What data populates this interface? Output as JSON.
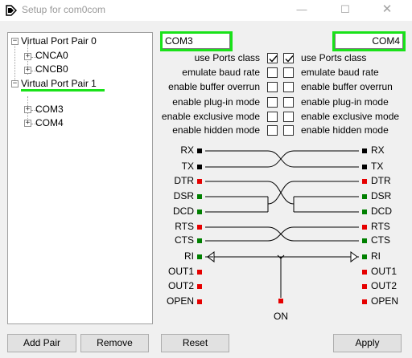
{
  "window": {
    "title": "Setup for com0com",
    "minimize": "—",
    "maximize": "☐",
    "close": "✕"
  },
  "tree": {
    "pairs": [
      {
        "label": "Virtual Port Pair 0",
        "toggle": "−",
        "children": [
          {
            "label": "CNCA0",
            "toggle": "+"
          },
          {
            "label": "CNCB0",
            "toggle": "+"
          }
        ]
      },
      {
        "label": "Virtual Port Pair 1",
        "toggle": "−",
        "children": [
          {
            "label": "COM3",
            "toggle": "+"
          },
          {
            "label": "COM4",
            "toggle": "+"
          }
        ]
      }
    ]
  },
  "ports": {
    "left_name": "COM3",
    "right_name": "COM4"
  },
  "options": {
    "left": [
      {
        "label": "use Ports class",
        "checked": true
      },
      {
        "label": "emulate baud rate",
        "checked": false
      },
      {
        "label": "enable buffer overrun",
        "checked": false
      },
      {
        "label": "enable plug-in mode",
        "checked": false
      },
      {
        "label": "enable exclusive mode",
        "checked": false
      },
      {
        "label": "enable hidden mode",
        "checked": false
      }
    ],
    "right": [
      {
        "label": "use Ports class",
        "checked": true
      },
      {
        "label": "emulate baud rate",
        "checked": false
      },
      {
        "label": "enable buffer overrun",
        "checked": false
      },
      {
        "label": "enable plug-in mode",
        "checked": false
      },
      {
        "label": "enable exclusive mode",
        "checked": false
      },
      {
        "label": "enable hidden mode",
        "checked": false
      }
    ]
  },
  "signals": {
    "left": [
      "RX",
      "TX",
      "DTR",
      "DSR",
      "DCD",
      "RTS",
      "CTS",
      "RI",
      "OUT1",
      "OUT2",
      "OPEN"
    ],
    "right": [
      "RX",
      "TX",
      "DTR",
      "DSR",
      "DCD",
      "RTS",
      "CTS",
      "RI",
      "OUT1",
      "OUT2",
      "OPEN"
    ],
    "pin_colors": {
      "left": [
        "#000000",
        "#000000",
        "#e60000",
        "#008000",
        "#008000",
        "#e60000",
        "#008000",
        "#008000",
        "#e60000",
        "#e60000",
        "#e60000"
      ],
      "right": [
        "#000000",
        "#000000",
        "#e60000",
        "#008000",
        "#008000",
        "#e60000",
        "#008000",
        "#008000",
        "#e60000",
        "#e60000",
        "#e60000"
      ]
    },
    "on_label": "ON",
    "on_color": "#e60000"
  },
  "buttons": {
    "add_pair": "Add Pair",
    "remove": "Remove",
    "reset": "Reset",
    "apply": "Apply"
  },
  "colors": {
    "highlight": "#19e219"
  }
}
